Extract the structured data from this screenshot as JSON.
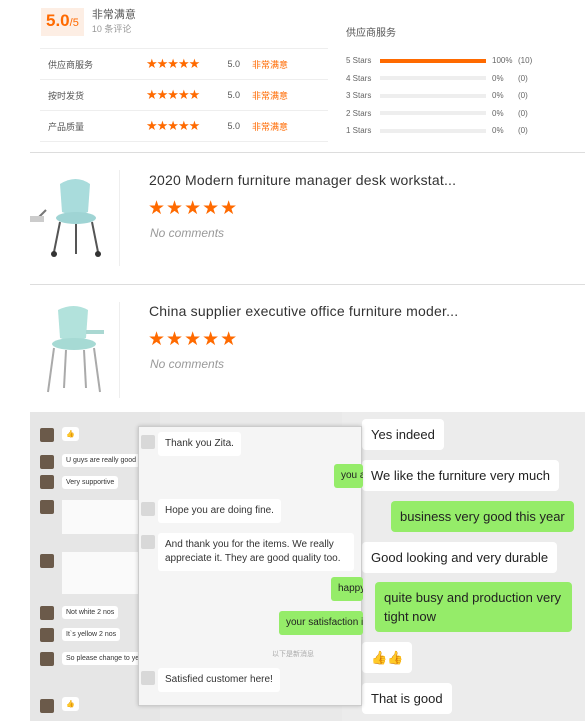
{
  "summary": {
    "score": "5.0",
    "score_suffix": "/5",
    "label": "非常满意",
    "count": "10 条评论"
  },
  "ratings": [
    {
      "label": "供应商服务",
      "stars": "★★★★★",
      "value": "5.0",
      "sat": "非常满意"
    },
    {
      "label": "按时发货",
      "stars": "★★★★★",
      "value": "5.0",
      "sat": "非常满意"
    },
    {
      "label": "产品质量",
      "stars": "★★★★★",
      "value": "5.0",
      "sat": "非常满意"
    }
  ],
  "distribution": {
    "title": "供应商服务",
    "rows": [
      {
        "label": "5 Stars",
        "fraction": 1.0,
        "pct": "100%",
        "count": "(10)"
      },
      {
        "label": "4 Stars",
        "fraction": 0,
        "pct": "0%",
        "count": "(0)"
      },
      {
        "label": "3 Stars",
        "fraction": 0,
        "pct": "0%",
        "count": "(0)"
      },
      {
        "label": "2 Stars",
        "fraction": 0,
        "pct": "0%",
        "count": "(0)"
      },
      {
        "label": "1 Stars",
        "fraction": 0,
        "pct": "0%",
        "count": "(0)"
      }
    ]
  },
  "products": [
    {
      "title": "2020 Modern furniture manager desk workstat...",
      "stars": "★★★★★",
      "no_comments": "No comments"
    },
    {
      "title": "China supplier executive office furniture moder...",
      "stars": "★★★★★",
      "no_comments": "No comments"
    }
  ],
  "chat": {
    "left": [
      "👍",
      "U guys are really good",
      "Very supportive",
      "Not white 2 nos",
      "It`s yellow 2 nos",
      "So please change to ye",
      "👍"
    ],
    "middle": {
      "b1": "Thank you Zita.",
      "g1": "you a",
      "b2": "Hope you are doing fine.",
      "b3": "And thank you for the items. We really appreciate it. They are good quality too.",
      "g2": "happy",
      "g3": "your satisfaction is",
      "divider": "以下是新消息",
      "b4": "Satisfied customer here!"
    },
    "right": {
      "r1": "Yes indeed",
      "r2": "We like the furniture very much",
      "g1": "business very good this year",
      "r3": "Good looking and very durable",
      "g2": "quite busy and production very tight now",
      "r4": "👍👍",
      "r5": "That is good"
    },
    "colors": {
      "green": "#95ec69",
      "accent": "#ff6a00"
    }
  }
}
